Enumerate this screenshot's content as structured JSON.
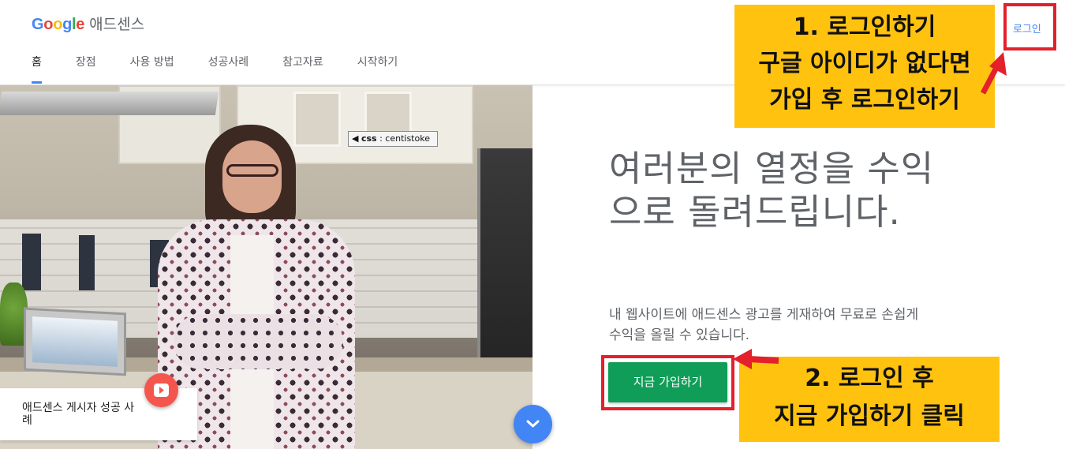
{
  "header": {
    "logo_google": "Google",
    "logo_product": "애드센스",
    "login_label": "로그인",
    "nav": [
      {
        "label": "홈",
        "active": true
      },
      {
        "label": "장점",
        "active": false
      },
      {
        "label": "사용 방법",
        "active": false
      },
      {
        "label": "성공사례",
        "active": false
      },
      {
        "label": "참고자료",
        "active": false
      },
      {
        "label": "시작하기",
        "active": false
      }
    ]
  },
  "hero": {
    "watermark_tag": "css",
    "watermark_text": ": centistoke",
    "story_card_text": "애드센스 게시자 성공 사례",
    "youtube_icon": "play-icon",
    "scroll_icon": "chevron-down-icon"
  },
  "main": {
    "headline": "여러분의 열정을 수익으로 돌려드립니다.",
    "description": "내 웹사이트에 애드센스 광고를 게재하여 무료로 손쉽게 수익을 올릴 수 있습니다.",
    "cta_label": "지금 가입하기"
  },
  "annotations": {
    "note1_lines": [
      "1. 로그인하기",
      "구글 아이디가 없다면",
      "가입 후 로그인하기"
    ],
    "note2_lines": [
      "2. 로그인 후",
      "지금 가입하기 클릭"
    ]
  },
  "colors": {
    "google_blue": "#4285f4",
    "google_red": "#ea4335",
    "google_yellow": "#fbbc05",
    "google_green": "#34a853",
    "cta_green": "#0f9d58",
    "annotation_yellow": "#ffc20e",
    "annotation_red": "#e3202b"
  }
}
